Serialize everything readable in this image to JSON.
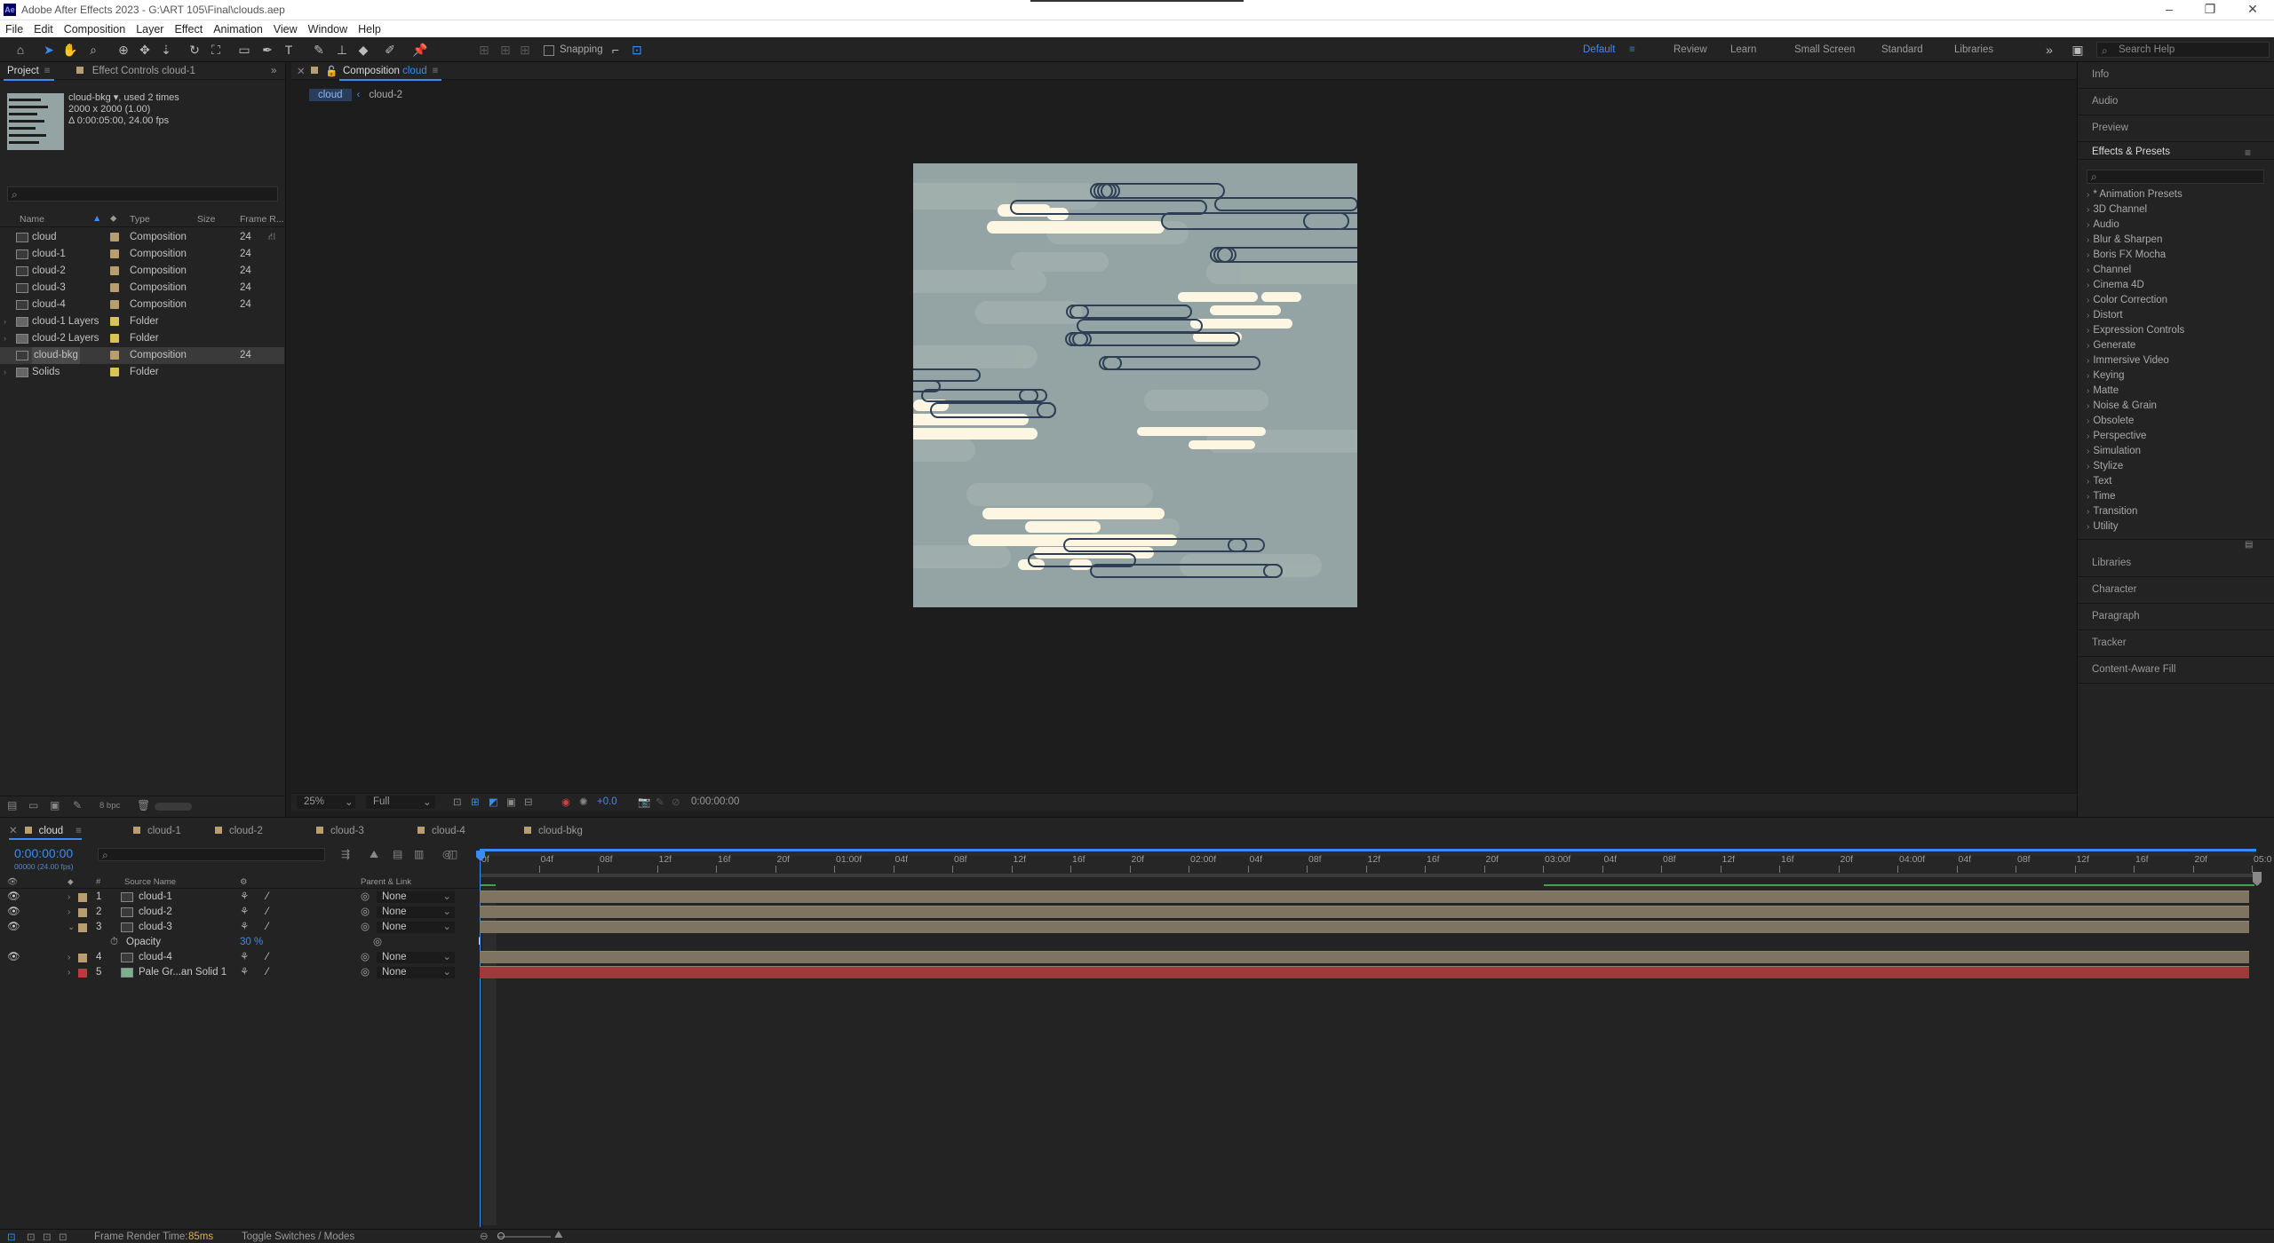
{
  "window": {
    "title": "Adobe After Effects 2023 - G:\\ART 105\\Final\\clouds.aep",
    "logo": "Ae"
  },
  "menu": [
    "File",
    "Edit",
    "Composition",
    "Layer",
    "Effect",
    "Animation",
    "View",
    "Window",
    "Help"
  ],
  "toolbar": {
    "snapping_label": "Snapping",
    "search_placeholder": "Search Help"
  },
  "workspaces": [
    {
      "label": "Default",
      "active": true
    },
    {
      "label": "Review",
      "active": false
    },
    {
      "label": "Learn",
      "active": false
    },
    {
      "label": "Small Screen",
      "active": false
    },
    {
      "label": "Standard",
      "active": false
    },
    {
      "label": "Libraries",
      "active": false
    }
  ],
  "project_panel": {
    "tab_label": "Project",
    "effect_controls_label": "Effect Controls cloud-1",
    "selected_item": {
      "name": "cloud-bkg",
      "used": ", used 2 times",
      "size": "2000 x 2000 (1.00)",
      "duration": "Δ 0:00:05:00, 24.00 fps"
    },
    "columns": {
      "name": "Name",
      "type": "Type",
      "size": "Size",
      "frame_rate": "Frame R..."
    },
    "items": [
      {
        "name": "cloud",
        "type": "Composition",
        "fps": "24",
        "color": "#b89d6e",
        "kind": "comp",
        "selected": false
      },
      {
        "name": "cloud-1",
        "type": "Composition",
        "fps": "24",
        "color": "#b89d6e",
        "kind": "comp",
        "selected": false
      },
      {
        "name": "cloud-2",
        "type": "Composition",
        "fps": "24",
        "color": "#b89d6e",
        "kind": "comp",
        "selected": false
      },
      {
        "name": "cloud-3",
        "type": "Composition",
        "fps": "24",
        "color": "#b89d6e",
        "kind": "comp",
        "selected": false
      },
      {
        "name": "cloud-4",
        "type": "Composition",
        "fps": "24",
        "color": "#b89d6e",
        "kind": "comp",
        "selected": false
      },
      {
        "name": "cloud-1 Layers",
        "type": "Folder",
        "fps": "",
        "color": "#d9c453",
        "kind": "folder",
        "selected": false
      },
      {
        "name": "cloud-2 Layers",
        "type": "Folder",
        "fps": "",
        "color": "#d9c453",
        "kind": "folder",
        "selected": false
      },
      {
        "name": "cloud-bkg",
        "type": "Composition",
        "fps": "24",
        "color": "#b89d6e",
        "kind": "comp",
        "selected": true
      },
      {
        "name": "Solids",
        "type": "Folder",
        "fps": "",
        "color": "#d9c453",
        "kind": "folder",
        "selected": false
      }
    ],
    "bpc": "8 bpc"
  },
  "composition_panel": {
    "tab_prefix": "Composition",
    "tab_name": "cloud",
    "breadcrumb": [
      "cloud",
      "cloud-2"
    ],
    "zoom": "25%",
    "resolution": "Full",
    "exposure": "+0.0",
    "timecode": "0:00:00:00",
    "bg_color": "#94a4a4"
  },
  "right_panels": {
    "collapsed_top": [
      "Info",
      "Audio",
      "Preview"
    ],
    "effects_title": "Effects & Presets",
    "effects": [
      "* Animation Presets",
      "3D Channel",
      "Audio",
      "Blur & Sharpen",
      "Boris FX Mocha",
      "Channel",
      "Cinema 4D",
      "Color Correction",
      "Distort",
      "Expression Controls",
      "Generate",
      "Immersive Video",
      "Keying",
      "Matte",
      "Noise & Grain",
      "Obsolete",
      "Perspective",
      "Simulation",
      "Stylize",
      "Text",
      "Time",
      "Transition",
      "Utility"
    ],
    "collapsed_bottom": [
      "Libraries",
      "Character",
      "Paragraph",
      "Tracker",
      "Content-Aware Fill"
    ]
  },
  "timeline": {
    "tabs": [
      "cloud",
      "cloud-1",
      "cloud-2",
      "cloud-3",
      "cloud-4",
      "cloud-bkg"
    ],
    "timecode": "0:00:00:00",
    "timecode_sub": "00000 (24.00 fps)",
    "columns": {
      "source": "Source Name",
      "parent": "Parent & Link"
    },
    "ruler": [
      "0f",
      "04f",
      "08f",
      "12f",
      "16f",
      "20f",
      "01:00f",
      "04f",
      "08f",
      "12f",
      "16f",
      "20f",
      "02:00f",
      "04f",
      "08f",
      "12f",
      "16f",
      "20f",
      "03:00f",
      "04f",
      "08f",
      "12f",
      "16f",
      "20f",
      "04:00f",
      "04f",
      "08f",
      "12f",
      "16f",
      "20f",
      "05:0"
    ],
    "layers": [
      {
        "num": "1",
        "name": "cloud-1",
        "parent": "None",
        "label": "#b89d6e",
        "bar": "#7f7361",
        "eye": true
      },
      {
        "num": "2",
        "name": "cloud-2",
        "parent": "None",
        "label": "#b89d6e",
        "bar": "#7f7361",
        "eye": true
      },
      {
        "num": "3",
        "name": "cloud-3",
        "parent": "None",
        "label": "#b89d6e",
        "bar": "#7f7361",
        "eye": true
      },
      {
        "num": "4",
        "name": "cloud-4",
        "parent": "None",
        "label": "#b89d6e",
        "bar": "#7f7361",
        "eye": true
      },
      {
        "num": "5",
        "name": "Pale Gr...an Solid 1",
        "parent": "None",
        "label": "#c4373f",
        "bar": "#9e3a3c",
        "eye": false
      }
    ],
    "opacity": {
      "label": "Opacity",
      "value": "30 %"
    }
  },
  "status": {
    "render_label": "Frame Render Time:",
    "render_value": "85ms",
    "toggle_label": "Toggle Switches / Modes"
  },
  "colors": {
    "accent": "#3a8cf5",
    "cloud_cream": "#fdf6e3",
    "cloud_outline": "#2f3e54"
  }
}
